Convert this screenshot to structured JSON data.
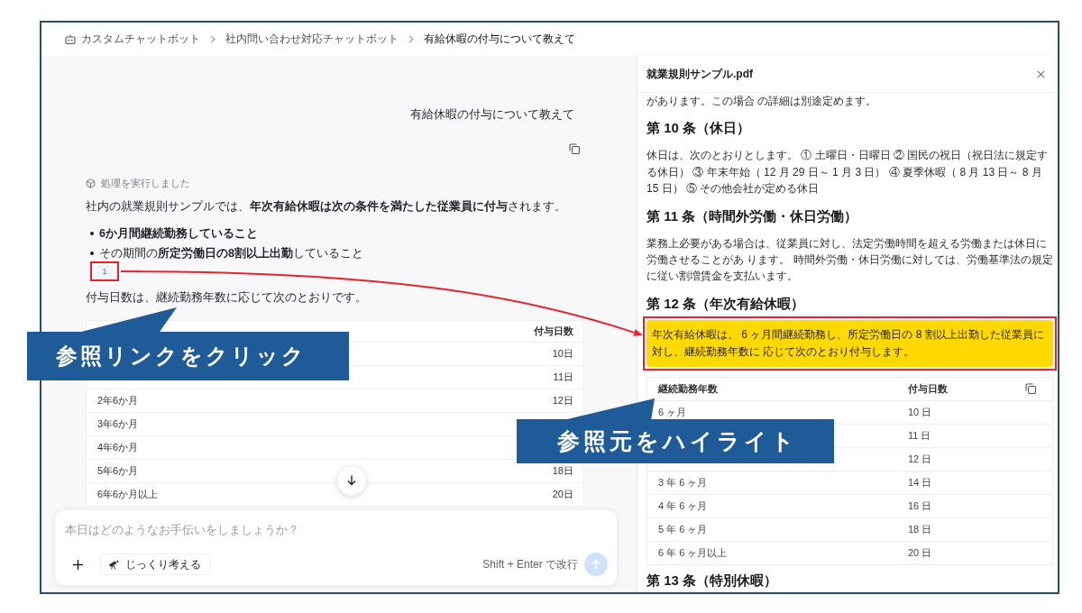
{
  "breadcrumb": [
    {
      "label": "カスタムチャットボット",
      "current": false
    },
    {
      "label": "社内問い合わせ対応チャットボット",
      "current": false
    },
    {
      "label": "有給休暇の付与について教えて",
      "current": true
    }
  ],
  "chat": {
    "user_message": "有給休暇の付与について教えて",
    "status": "処理を実行しました",
    "answer": {
      "intro": "社内の就業規則サンプルでは、**年次有給休暇は次の条件を満たした従業員に付与**されます。",
      "bullets": [
        {
          "text": "6か月間継続勤務していること",
          "bold": true
        },
        {
          "text": "その期間の**所定労働日の8割以上出勤**していること",
          "bold": false
        }
      ],
      "citation": "1",
      "outro": "付与日数は、継続勤務年数に応じて次のとおりです。",
      "table": {
        "header": {
          "column_2": "付与日数"
        },
        "rows": [
          {
            "column_2": "10日"
          },
          {
            "column_2": "11日"
          },
          {
            "column_1": "2年6か月",
            "column_2": "12日"
          },
          {
            "column_1": "3年6か月"
          },
          {
            "column_1": "4年6か月"
          },
          {
            "column_1": "5年6か月",
            "column_2": "18日"
          },
          {
            "column_1": "6年6か月以上",
            "column_2": "20日"
          }
        ]
      }
    },
    "composer": {
      "placeholder": "本日はどのようなお手伝いをしましょうか？",
      "think_button": "じっくり考える",
      "hint": "Shift + Enter で改行"
    }
  },
  "document": {
    "file_name": "就業規則サンプル.pdf",
    "blocks": [
      {
        "kind": "paragraph",
        "text": "があります。この場合 の詳細は別途定めます。",
        "highlighted": false
      },
      {
        "kind": "heading",
        "text": "第 10 条（休日）"
      },
      {
        "kind": "paragraph",
        "text": "休日は、次のとおりとします。 ① 土曜日・日曜日 ② 国民の祝日（祝日法に規定する休日） ③ 年末年始（ 12 月 29 日～ 1 月 3 日） ④ 夏季休暇（ 8 月 13 日～ 8 月 15 日） ⑤ その他会社が定める休日",
        "highlighted": false
      },
      {
        "kind": "heading",
        "text": "第 11 条（時間外労働・休日労働）"
      },
      {
        "kind": "paragraph",
        "text": "業務上必要がある場合は、従業員に対し、法定労働時間を超える労働または休日に労働させることがあ ります。 時間外労働・休日労働に対しては、労働基準法の規定に従い割増賃金を支払います。",
        "highlighted": false
      },
      {
        "kind": "heading",
        "text": "第 12 条（年次有給休暇）"
      },
      {
        "kind": "paragraph",
        "text": "年次有給休暇は、 6 ヶ月間継続勤務し、所定労働日の 8 割以上出勤した従業員に対し、継続勤務年数に 応じて次のとおり付与します。",
        "highlighted": true
      },
      {
        "kind": "table",
        "header": {
          "column_1": "継続勤務年数",
          "column_2": "付与日数"
        },
        "rows": [
          {
            "column_1": "6 ヶ月",
            "column_2": "10 日"
          },
          {
            "column_2": "11 日"
          },
          {
            "column_2": "12 日"
          },
          {
            "column_1": "3 年 6 ヶ月",
            "column_2": "14 日"
          },
          {
            "column_1": "4 年 6 ヶ月",
            "column_2": "16 日"
          },
          {
            "column_1": "5 年 6 ヶ月",
            "column_2": "18 日"
          },
          {
            "column_1": "6 年 6 ヶ月以上",
            "column_2": "20 日"
          }
        ]
      },
      {
        "kind": "heading",
        "text": "第 13 条（特別休暇）"
      }
    ]
  },
  "annotations": {
    "callouts": [
      {
        "text": "参照リンクをクリック"
      },
      {
        "text": "参照元をハイライト"
      }
    ]
  }
}
